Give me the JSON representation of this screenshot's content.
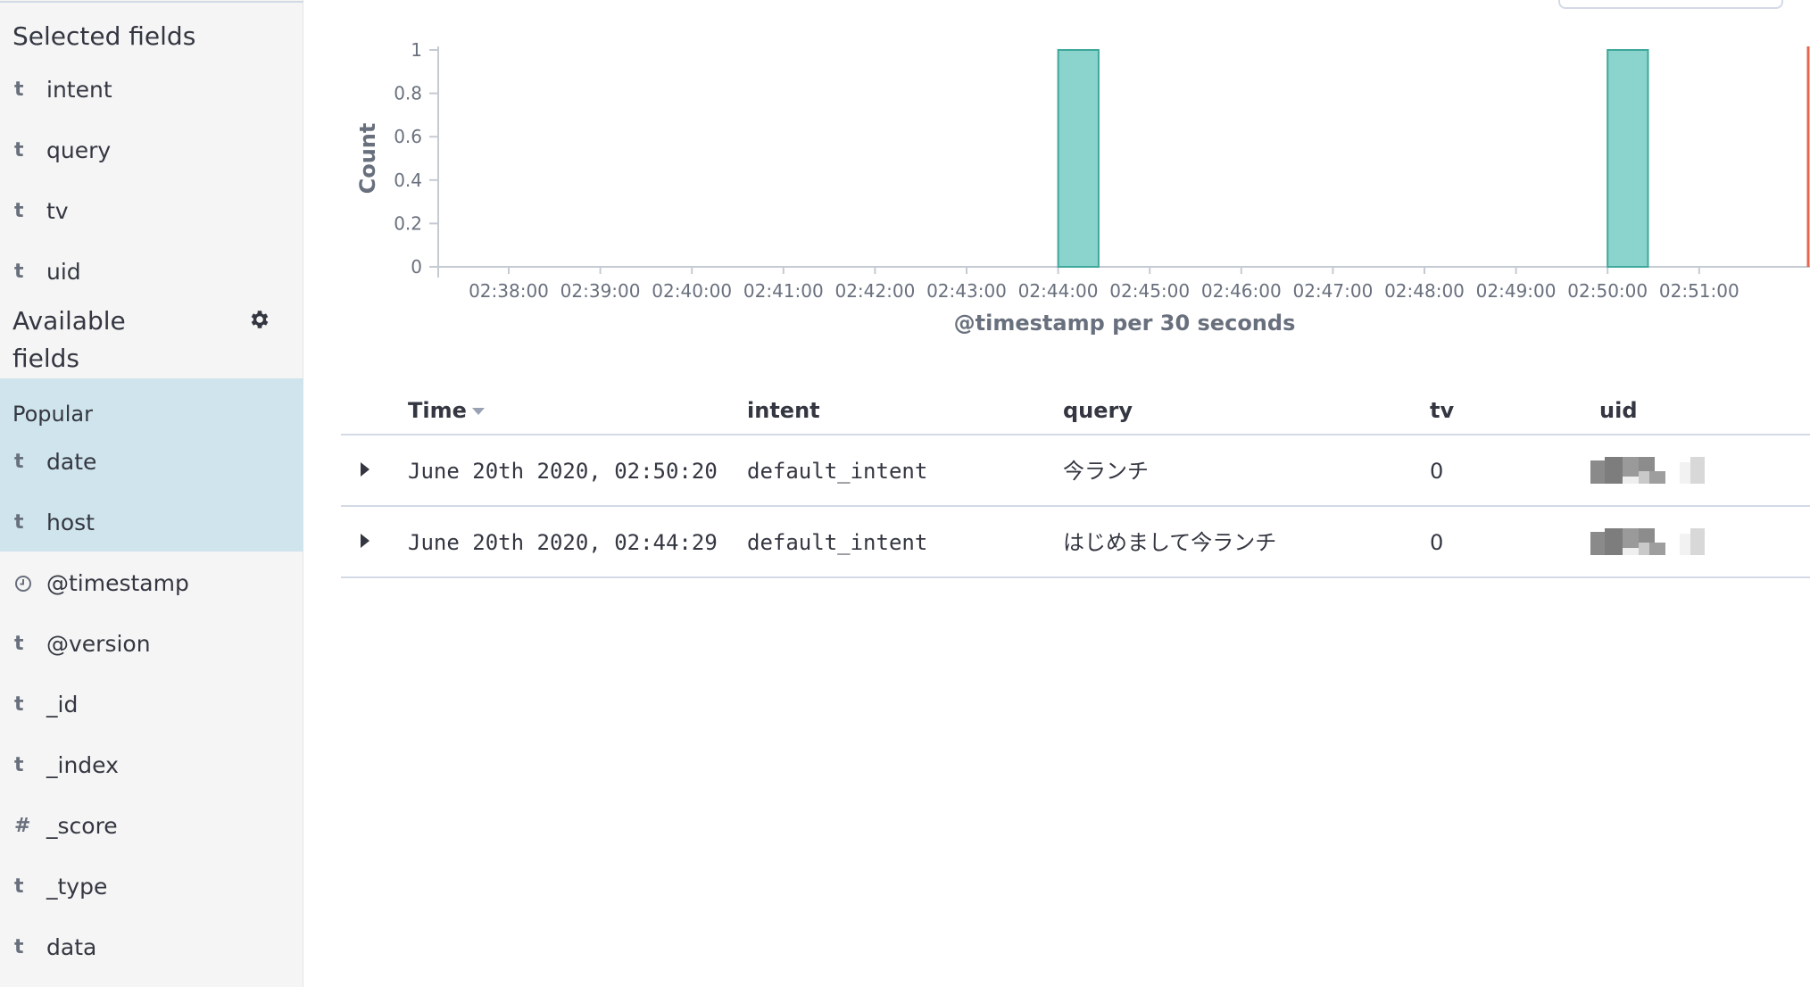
{
  "sidebar": {
    "selected_title": "Selected fields",
    "selected_fields": [
      {
        "type": "t",
        "name": "intent"
      },
      {
        "type": "t",
        "name": "query"
      },
      {
        "type": "t",
        "name": "tv"
      },
      {
        "type": "t",
        "name": "uid"
      }
    ],
    "available_title_line1": "Available",
    "available_title_line2": "fields",
    "popular_label": "Popular",
    "popular_fields": [
      {
        "type": "t",
        "name": "date"
      },
      {
        "type": "t",
        "name": "host"
      }
    ],
    "other_fields": [
      {
        "type": "clock",
        "name": "@timestamp"
      },
      {
        "type": "t",
        "name": "@version"
      },
      {
        "type": "t",
        "name": "_id"
      },
      {
        "type": "t",
        "name": "_index"
      },
      {
        "type": "#",
        "name": "_score"
      },
      {
        "type": "t",
        "name": "_type"
      },
      {
        "type": "t",
        "name": "data"
      }
    ]
  },
  "chart_data": {
    "type": "bar",
    "ylabel": "Count",
    "xlabel": "@timestamp per 30 seconds",
    "ylim": [
      0,
      1
    ],
    "yticks": [
      "0",
      "0.2",
      "0.4",
      "0.6",
      "0.8",
      "1"
    ],
    "xticks": [
      "02:38:00",
      "02:39:00",
      "02:40:00",
      "02:41:00",
      "02:42:00",
      "02:43:00",
      "02:44:00",
      "02:45:00",
      "02:46:00",
      "02:47:00",
      "02:48:00",
      "02:49:00",
      "02:50:00",
      "02:51:00"
    ],
    "bars": [
      {
        "x": "02:44:00",
        "value": 1
      },
      {
        "x": "02:50:00",
        "value": 1
      }
    ],
    "bar_color": "#8ad4cd",
    "bar_border": "#3fa79b"
  },
  "table": {
    "headers": {
      "time": "Time",
      "intent": "intent",
      "query": "query",
      "tv": "tv",
      "uid": "uid"
    },
    "rows": [
      {
        "time": "June 20th 2020, 02:50:20",
        "intent": "default_intent",
        "query": "今ランチ",
        "tv": "0"
      },
      {
        "time": "June 20th 2020, 02:44:29",
        "intent": "default_intent",
        "query": "はじめまして今ランチ",
        "tv": "0"
      }
    ]
  }
}
